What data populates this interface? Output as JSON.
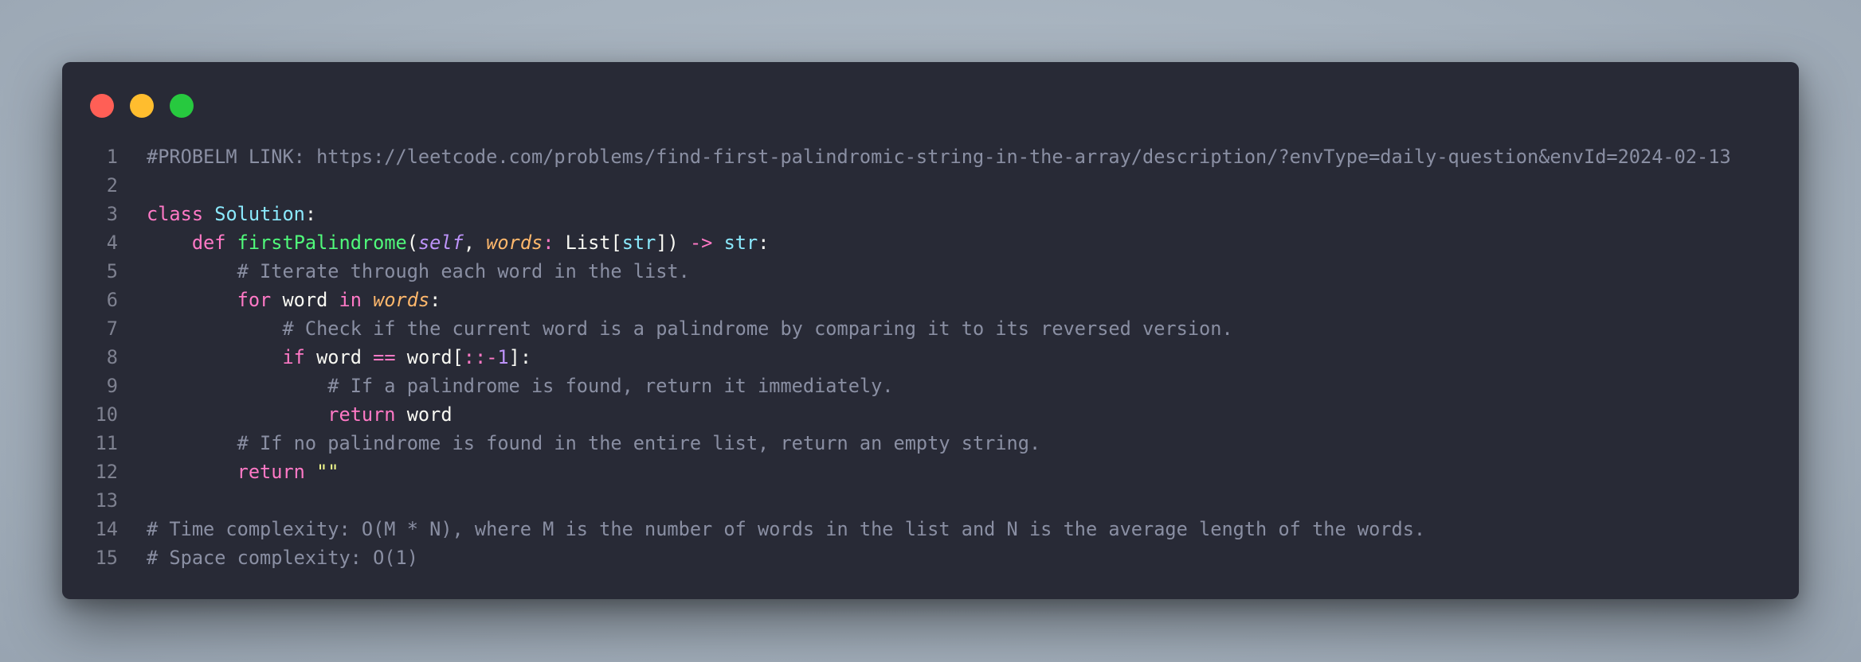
{
  "window": {
    "controls": [
      {
        "name": "close-dot",
        "color": "#ff5f56"
      },
      {
        "name": "minimize-dot",
        "color": "#ffbd2e"
      },
      {
        "name": "maximize-dot",
        "color": "#27c93f"
      }
    ]
  },
  "code": {
    "lines": [
      {
        "n": "1",
        "tokens": [
          {
            "t": "#PROBELM LINK: https://leetcode.com/problems/find-first-palindromic-string-in-the-array/description/?envType=daily-question&envId=2024-02-13",
            "c": "comment"
          }
        ]
      },
      {
        "n": "2",
        "tokens": []
      },
      {
        "n": "3",
        "tokens": [
          {
            "t": "class",
            "c": "keyword"
          },
          {
            "t": " ",
            "c": "plain"
          },
          {
            "t": "Solution",
            "c": "class"
          },
          {
            "t": ":",
            "c": "plain"
          }
        ]
      },
      {
        "n": "4",
        "tokens": [
          {
            "t": "    ",
            "c": "plain"
          },
          {
            "t": "def",
            "c": "keyword"
          },
          {
            "t": " ",
            "c": "plain"
          },
          {
            "t": "firstPalindrome",
            "c": "func"
          },
          {
            "t": "(",
            "c": "plain"
          },
          {
            "t": "self",
            "c": "self"
          },
          {
            "t": ", ",
            "c": "plain"
          },
          {
            "t": "words",
            "c": "param"
          },
          {
            "t": ":",
            "c": "op"
          },
          {
            "t": " List[",
            "c": "plain"
          },
          {
            "t": "str",
            "c": "type"
          },
          {
            "t": "]) ",
            "c": "plain"
          },
          {
            "t": "->",
            "c": "op"
          },
          {
            "t": " ",
            "c": "plain"
          },
          {
            "t": "str",
            "c": "type"
          },
          {
            "t": ":",
            "c": "plain"
          }
        ]
      },
      {
        "n": "5",
        "tokens": [
          {
            "t": "        ",
            "c": "plain"
          },
          {
            "t": "# Iterate through each word in the list.",
            "c": "comment"
          }
        ]
      },
      {
        "n": "6",
        "tokens": [
          {
            "t": "        ",
            "c": "plain"
          },
          {
            "t": "for",
            "c": "keyword"
          },
          {
            "t": " word ",
            "c": "plain"
          },
          {
            "t": "in",
            "c": "keyword"
          },
          {
            "t": " ",
            "c": "plain"
          },
          {
            "t": "words",
            "c": "param"
          },
          {
            "t": ":",
            "c": "plain"
          }
        ]
      },
      {
        "n": "7",
        "tokens": [
          {
            "t": "            ",
            "c": "plain"
          },
          {
            "t": "# Check if the current word is a palindrome by comparing it to its reversed version.",
            "c": "comment"
          }
        ]
      },
      {
        "n": "8",
        "tokens": [
          {
            "t": "            ",
            "c": "plain"
          },
          {
            "t": "if",
            "c": "keyword"
          },
          {
            "t": " word ",
            "c": "plain"
          },
          {
            "t": "==",
            "c": "op"
          },
          {
            "t": " word[",
            "c": "plain"
          },
          {
            "t": "::",
            "c": "op"
          },
          {
            "t": "-",
            "c": "op"
          },
          {
            "t": "1",
            "c": "number"
          },
          {
            "t": "]:",
            "c": "plain"
          }
        ]
      },
      {
        "n": "9",
        "tokens": [
          {
            "t": "                ",
            "c": "plain"
          },
          {
            "t": "# If a palindrome is found, return it immediately.",
            "c": "comment"
          }
        ]
      },
      {
        "n": "10",
        "tokens": [
          {
            "t": "                ",
            "c": "plain"
          },
          {
            "t": "return",
            "c": "keyword"
          },
          {
            "t": " word",
            "c": "plain"
          }
        ]
      },
      {
        "n": "11",
        "tokens": [
          {
            "t": "        ",
            "c": "plain"
          },
          {
            "t": "# If no palindrome is found in the entire list, return an empty string.",
            "c": "comment"
          }
        ]
      },
      {
        "n": "12",
        "tokens": [
          {
            "t": "        ",
            "c": "plain"
          },
          {
            "t": "return",
            "c": "keyword"
          },
          {
            "t": " ",
            "c": "plain"
          },
          {
            "t": "\"\"",
            "c": "string"
          }
        ]
      },
      {
        "n": "13",
        "tokens": []
      },
      {
        "n": "14",
        "tokens": [
          {
            "t": "# Time complexity: O(M * N), where M is the number of words in the list and N is the average length of the words.",
            "c": "comment"
          }
        ]
      },
      {
        "n": "15",
        "tokens": [
          {
            "t": "# Space complexity: O(1)",
            "c": "comment"
          }
        ]
      }
    ]
  }
}
